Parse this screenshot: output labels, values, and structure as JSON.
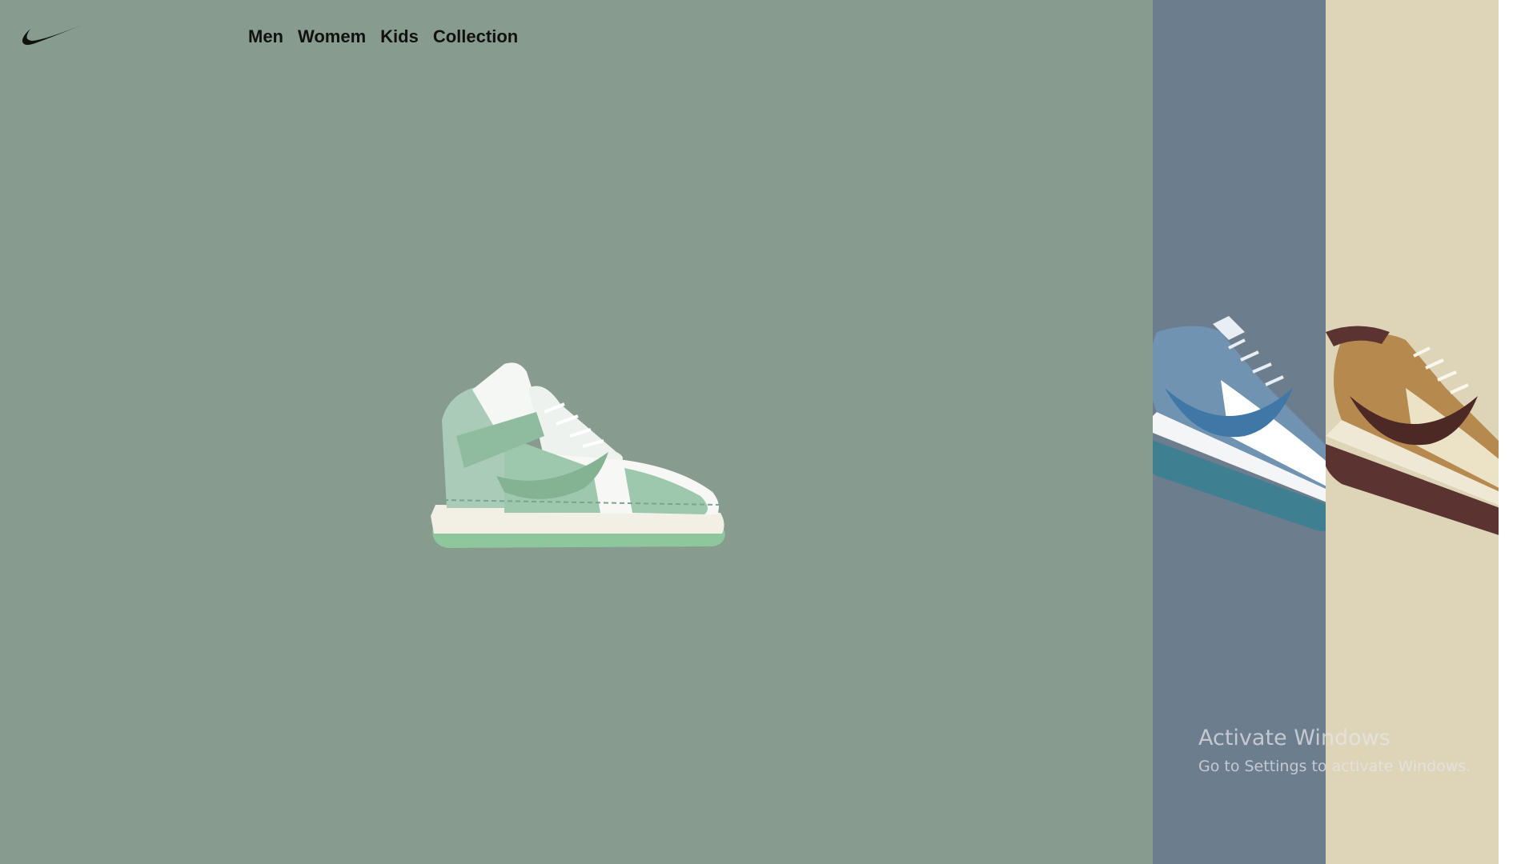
{
  "brand": {
    "logo_icon": "nike-swoosh-icon"
  },
  "nav": {
    "items": [
      {
        "label": "Men"
      },
      {
        "label": "Womem"
      },
      {
        "label": "Kids"
      },
      {
        "label": "Collection"
      }
    ]
  },
  "panels": [
    {
      "color": "#879b8e",
      "product_icon": "green-high-top-sneaker-icon"
    },
    {
      "color": "#6c7d8d",
      "product_icon": "blue-paisley-low-sneaker-icon"
    },
    {
      "color": "#ded5b8",
      "product_icon": "brown-tan-low-sneaker-icon"
    }
  ],
  "watermark": {
    "title": "Activate Windows",
    "subtitle": "Go to Settings to activate Windows."
  }
}
